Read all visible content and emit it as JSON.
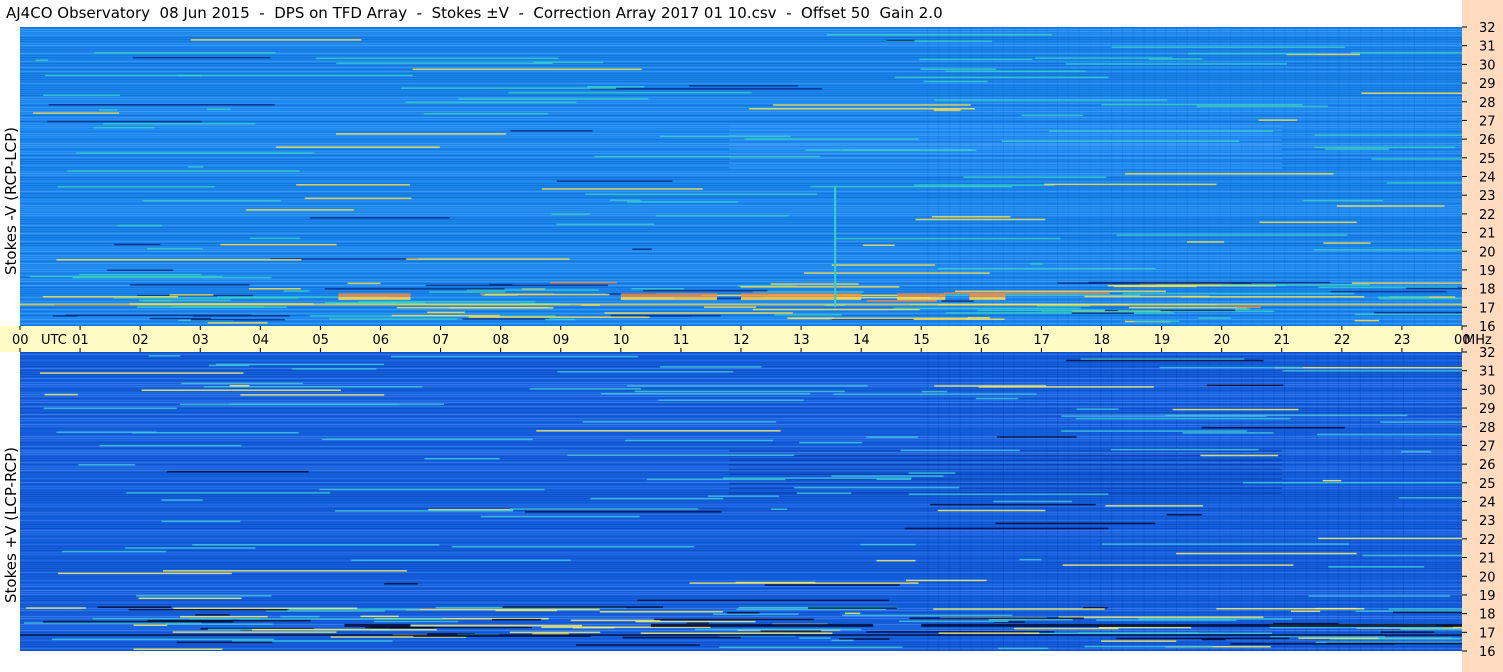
{
  "title": "AJ4CO Observatory  08 Jun 2015  -  DPS on TFD Array  -  Stokes ±V  -  Correction Array 2017 01 10.csv  -  Offset 50  Gain 2.0",
  "chart_data": [
    {
      "type": "heatmap",
      "panel": "top",
      "ylabel": "Stokes -V (RCP-LCP)",
      "x_ticks": [
        "00",
        "01",
        "02",
        "03",
        "04",
        "05",
        "06",
        "07",
        "08",
        "09",
        "10",
        "11",
        "12",
        "13",
        "14",
        "15",
        "16",
        "17",
        "18",
        "19",
        "20",
        "21",
        "22",
        "23",
        "00"
      ],
      "x_unit": "UTC",
      "y_ticks": [
        "16",
        "17",
        "18",
        "19",
        "20",
        "21",
        "22",
        "23",
        "24",
        "25",
        "26",
        "27",
        "28",
        "29",
        "30",
        "31",
        "32"
      ],
      "y_unit": "MHz",
      "ylim": [
        16,
        32
      ],
      "xlim_hours": [
        0,
        24
      ],
      "colors": {
        "background": "#1a86f0",
        "hot": "#ff8a3c",
        "strong": "#ffe14a",
        "mid": "#36d0c4",
        "dark": "#0b2a80"
      }
    },
    {
      "type": "heatmap",
      "panel": "bottom",
      "ylabel": "Stokes +V (LCP-RCP)",
      "x_ticks": [
        "00",
        "01",
        "02",
        "03",
        "04",
        "05",
        "06",
        "07",
        "08",
        "09",
        "10",
        "11",
        "12",
        "13",
        "14",
        "15",
        "16",
        "17",
        "18",
        "19",
        "20",
        "21",
        "22",
        "23",
        "00"
      ],
      "x_unit": "UTC",
      "y_ticks": [
        "16",
        "17",
        "18",
        "19",
        "20",
        "21",
        "22",
        "23",
        "24",
        "25",
        "26",
        "27",
        "28",
        "29",
        "30",
        "31",
        "32"
      ],
      "y_unit": "MHz",
      "ylim": [
        16,
        32
      ],
      "xlim_hours": [
        0,
        24
      ],
      "colors": {
        "background": "#1460e0",
        "strong": "#f7f06a",
        "mid": "#3fc8d8",
        "dark": "#050a30"
      }
    }
  ],
  "axis_colors": {
    "time_band": "#fffbc4",
    "freq_band": "#ffdcc0"
  }
}
